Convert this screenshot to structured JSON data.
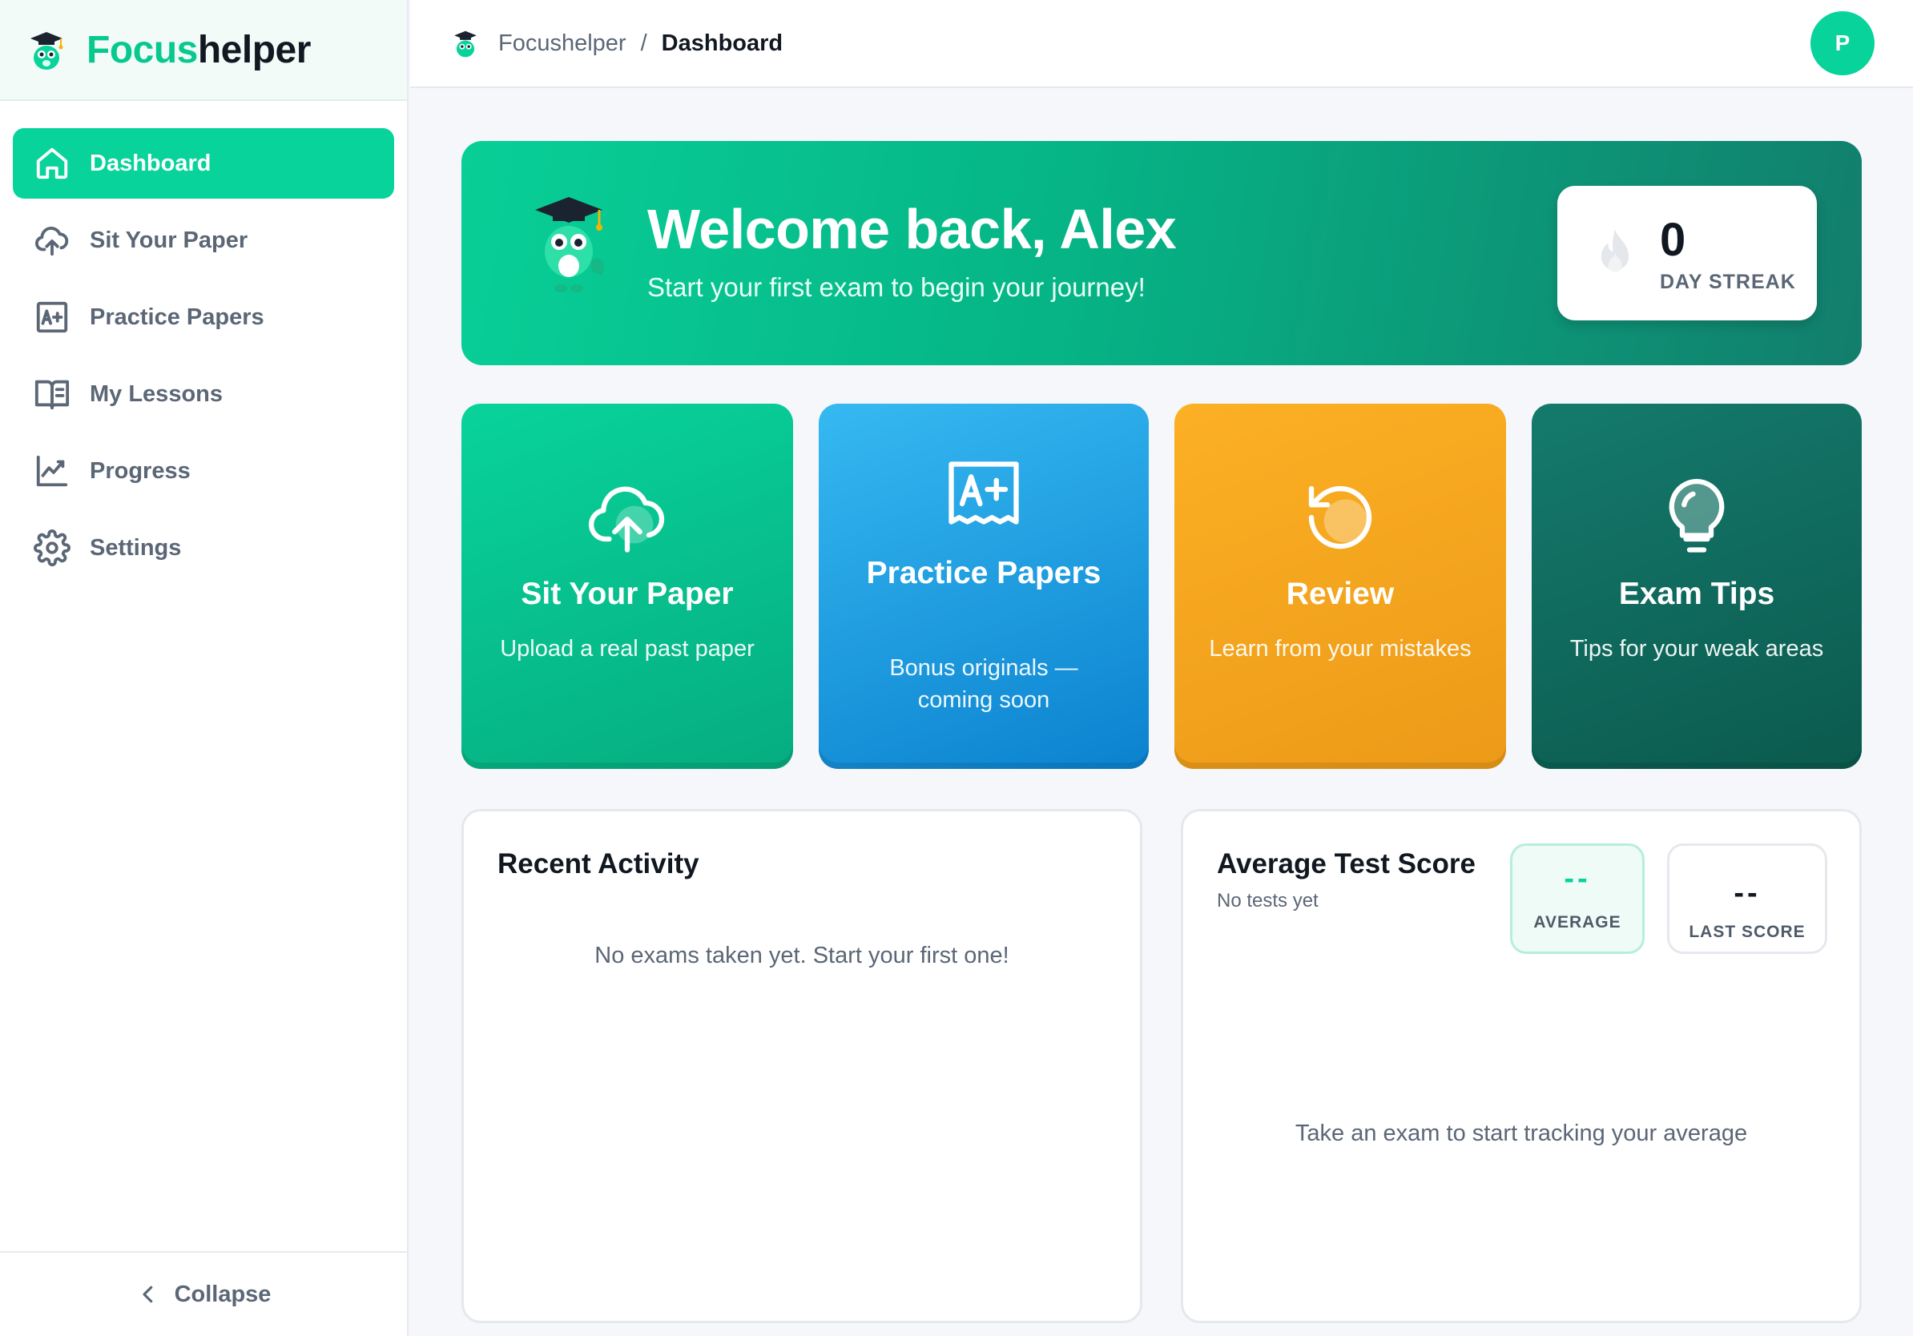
{
  "brand": {
    "name_part1": "Focus",
    "name_part2": "helper"
  },
  "sidebar": {
    "items": [
      {
        "label": "Dashboard",
        "icon": "home-icon",
        "active": true
      },
      {
        "label": "Sit Your Paper",
        "icon": "cloud-upload-icon"
      },
      {
        "label": "Practice Papers",
        "icon": "grade-paper-icon"
      },
      {
        "label": "My Lessons",
        "icon": "book-icon"
      },
      {
        "label": "Progress",
        "icon": "chart-line-icon"
      },
      {
        "label": "Settings",
        "icon": "gear-icon"
      }
    ],
    "collapse_label": "Collapse"
  },
  "header": {
    "breadcrumb_root": "Focushelper",
    "breadcrumb_sep": "/",
    "breadcrumb_current": "Dashboard",
    "avatar_initial": "P"
  },
  "hero": {
    "title": "Welcome back, Alex",
    "subtitle": "Start your first exam to begin your journey!",
    "streak_value": "0",
    "streak_label": "DAY STREAK"
  },
  "cards": [
    {
      "title": "Sit Your Paper",
      "desc": "Upload a real past paper",
      "icon": "cloud-upload-icon"
    },
    {
      "title": "Practice Papers",
      "desc": "Bonus originals — coming soon",
      "icon": "grade-paper-icon"
    },
    {
      "title": "Review",
      "desc": "Learn from your mistakes",
      "icon": "review-icon"
    },
    {
      "title": "Exam Tips",
      "desc": "Tips for your weak areas",
      "icon": "lightbulb-icon"
    }
  ],
  "recent_activity": {
    "title": "Recent Activity",
    "empty_text": "No exams taken yet. Start your first one!"
  },
  "average_score": {
    "title": "Average Test Score",
    "subtitle": "No tests yet",
    "average_value": "--",
    "average_label": "AVERAGE",
    "last_value": "--",
    "last_label": "LAST SCORE",
    "empty_text": "Take an exam to start tracking your average"
  },
  "colors": {
    "accent": "#08d39b",
    "blue": "#1fa2e6",
    "orange": "#f7a620",
    "dark_teal": "#0f6b5e"
  }
}
